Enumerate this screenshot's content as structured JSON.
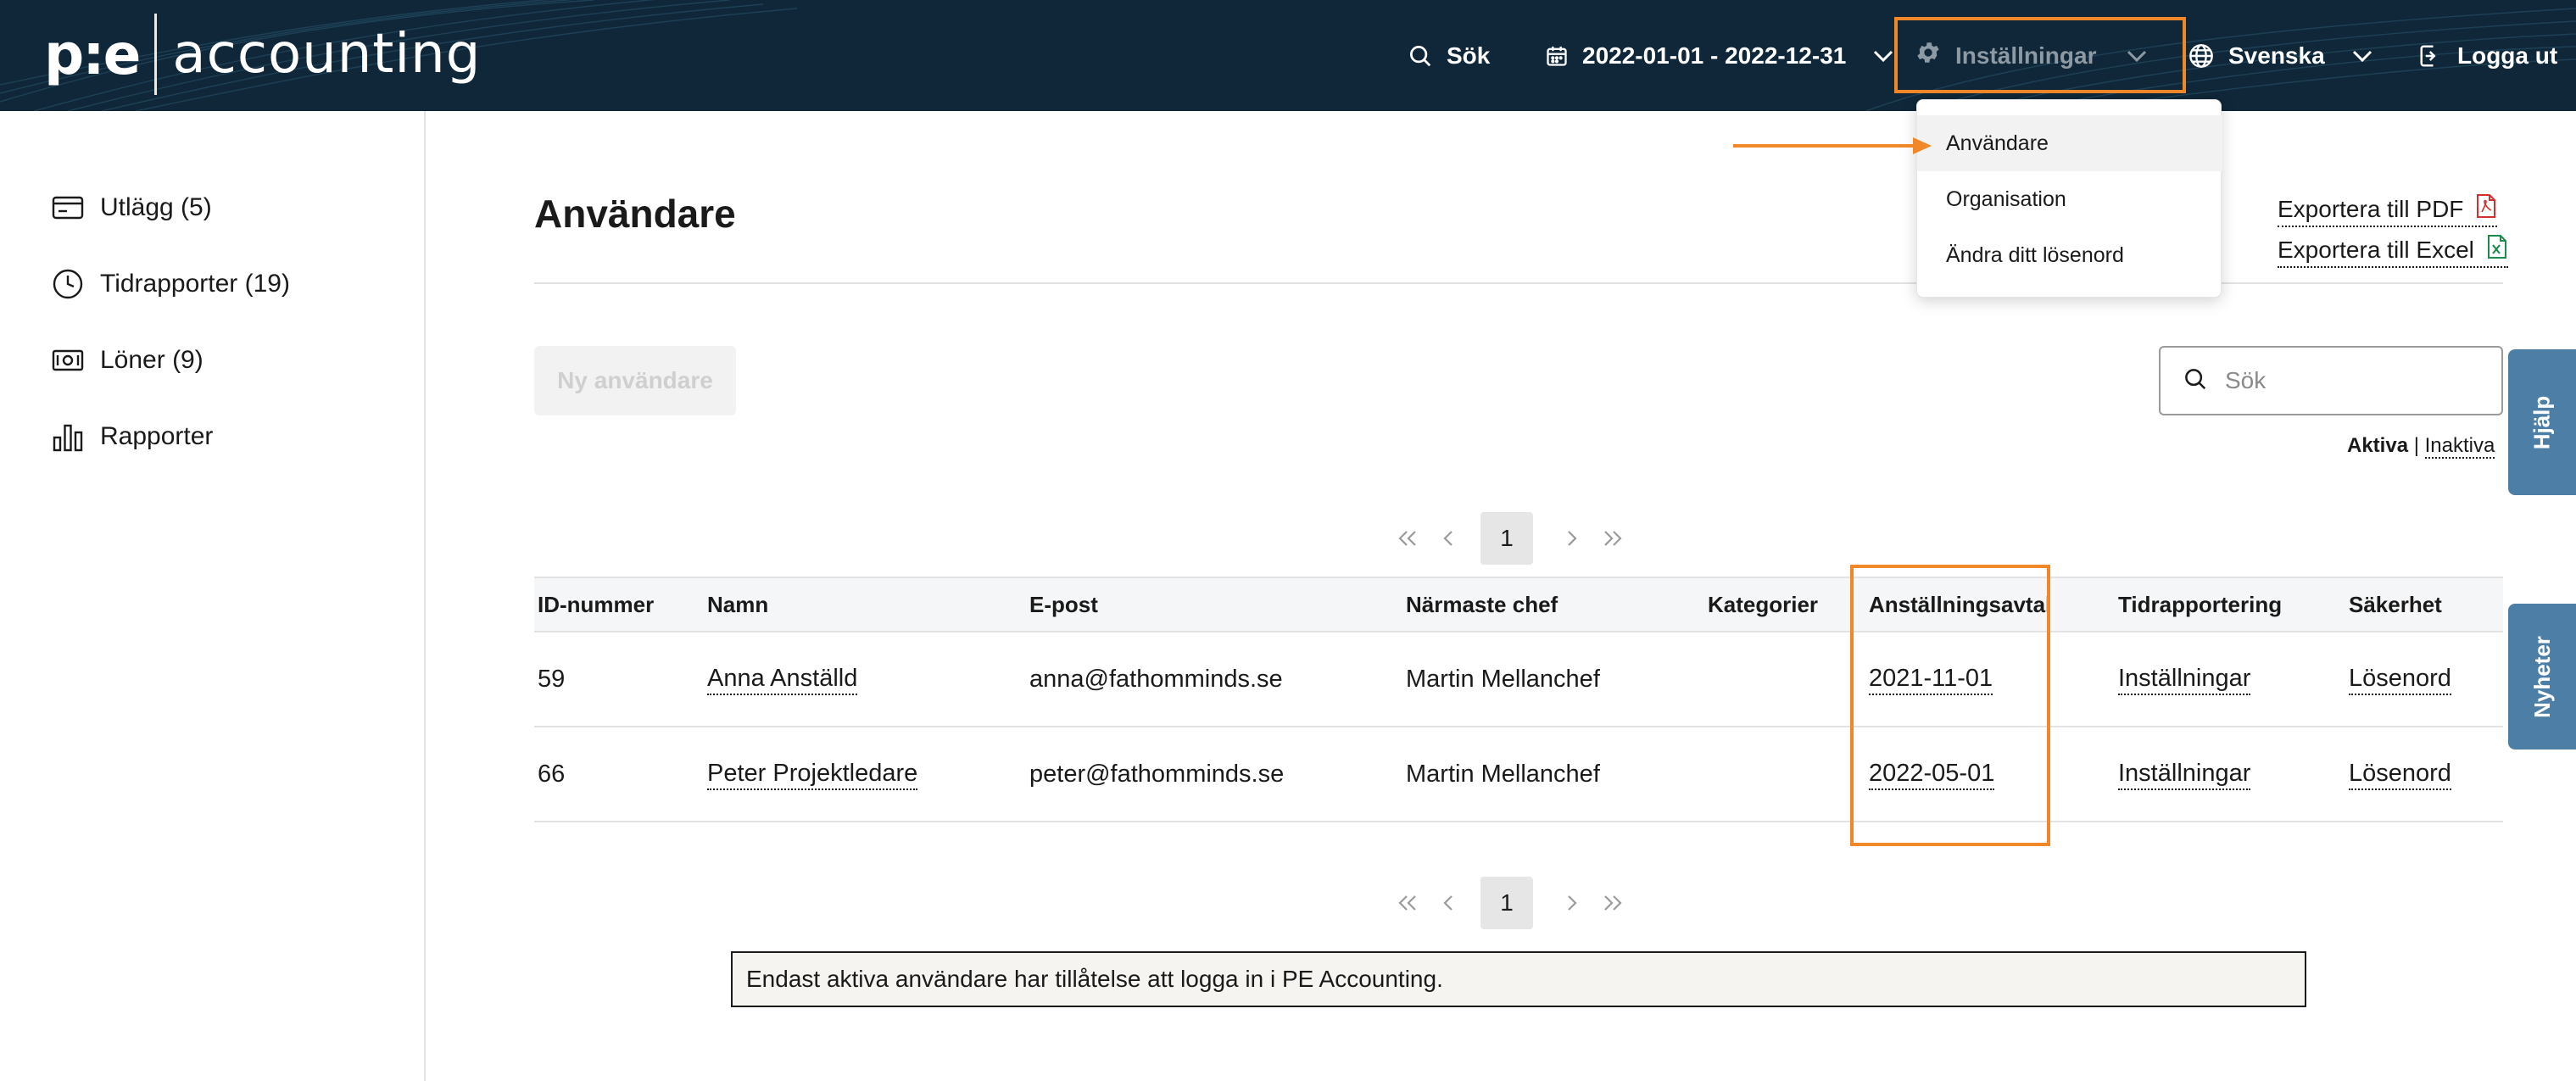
{
  "header": {
    "logo_mark": "p:e",
    "logo_text": "accounting",
    "search_label": "Sök",
    "date_range": "2022-01-01 - 2022-12-31",
    "settings_label": "Inställningar",
    "language_label": "Svenska",
    "logout_label": "Logga ut",
    "icons": [
      "search-icon",
      "calendar-icon",
      "chevron-down-icon",
      "gear-icon",
      "globe-icon",
      "logout-icon"
    ]
  },
  "settings_menu": {
    "items": [
      {
        "label": "Användare",
        "highlighted": true
      },
      {
        "label": "Organisation"
      },
      {
        "label": "Ändra ditt lösenord"
      }
    ]
  },
  "sidebar": {
    "items": [
      {
        "label": "Utlägg (5)",
        "icon": "receipt-card-icon"
      },
      {
        "label": "Tidrapporter (19)",
        "icon": "clock-icon"
      },
      {
        "label": "Löner (9)",
        "icon": "money-icon"
      },
      {
        "label": "Rapporter",
        "icon": "bar-chart-icon"
      }
    ]
  },
  "main": {
    "title": "Användare",
    "export_pdf": "Exportera till PDF",
    "export_excel": "Exportera till Excel",
    "new_user_button": "Ny användare",
    "search_placeholder": "Sök",
    "filter_active": "Aktiva",
    "filter_separator": "|",
    "filter_inactive": "Inaktiva",
    "page_current": "1",
    "columns": [
      "ID-nummer",
      "Namn",
      "E-post",
      "Närmaste chef",
      "Kategorier",
      "Anställningsavtal",
      "Tidrapportering",
      "Säkerhet"
    ],
    "rows": [
      {
        "id": "59",
        "name": "Anna Anställd",
        "email": "anna@fathomminds.se",
        "manager": "Martin Mellanchef",
        "categories": "",
        "contract": "2021-11-01",
        "timereport": "Inställningar",
        "security": "Lösenord"
      },
      {
        "id": "66",
        "name": "Peter Projektledare",
        "email": "peter@fathomminds.se",
        "manager": "Martin Mellanchef",
        "categories": "",
        "contract": "2022-05-01",
        "timereport": "Inställningar",
        "security": "Lösenord"
      }
    ],
    "notice": "Endast aktiva användare har tillåtelse att logga in i PE Accounting."
  },
  "side_tabs": {
    "help": "Hjälp",
    "news": "Nyheter"
  },
  "colors": {
    "header_bg": "#0f2738",
    "annotation_orange": "#f0882a",
    "side_tab_blue": "#4d7fa6"
  }
}
